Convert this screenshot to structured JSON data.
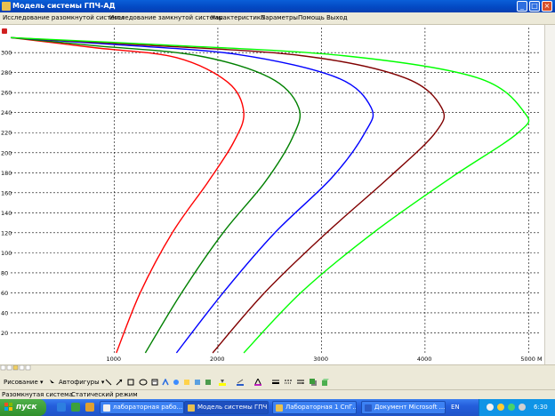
{
  "window": {
    "title": "Модель системы ГПЧ-АД",
    "minimize": "_",
    "maximize": "□",
    "close": "×"
  },
  "menu": [
    "Исследование разомкнутой системы",
    "Исследование замкнутой системы",
    "Характеристика",
    "Параметры",
    "Помощь",
    "Выход"
  ],
  "chart_data": {
    "type": "line",
    "xlabel": "M",
    "ylabel": "",
    "xlim": [
      0,
      5100
    ],
    "ylim": [
      0,
      325
    ],
    "x_ticks": [
      1000,
      2000,
      3000,
      4000,
      5000
    ],
    "y_ticks": [
      20,
      40,
      60,
      80,
      100,
      120,
      140,
      160,
      180,
      200,
      220,
      240,
      260,
      280,
      300
    ],
    "grid": "dashed",
    "series": [
      {
        "color": "#ff0000",
        "points": [
          [
            1020,
            0
          ],
          [
            1250,
            60
          ],
          [
            1560,
            120
          ],
          [
            1900,
            170
          ],
          [
            2150,
            210
          ],
          [
            2250,
            240
          ],
          [
            2100,
            270
          ],
          [
            1600,
            295
          ],
          [
            800,
            305
          ],
          [
            0,
            315
          ]
        ]
      },
      {
        "color": "#008000",
        "points": [
          [
            1300,
            0
          ],
          [
            1650,
            60
          ],
          [
            2050,
            120
          ],
          [
            2450,
            170
          ],
          [
            2720,
            215
          ],
          [
            2780,
            245
          ],
          [
            2500,
            275
          ],
          [
            1800,
            297
          ],
          [
            800,
            307
          ],
          [
            0,
            315
          ]
        ]
      },
      {
        "color": "#0000ff",
        "points": [
          [
            1600,
            0
          ],
          [
            2050,
            60
          ],
          [
            2550,
            120
          ],
          [
            3100,
            175
          ],
          [
            3420,
            220
          ],
          [
            3480,
            245
          ],
          [
            3150,
            275
          ],
          [
            2200,
            298
          ],
          [
            1000,
            308
          ],
          [
            0,
            315
          ]
        ]
      },
      {
        "color": "#800000",
        "points": [
          [
            1950,
            0
          ],
          [
            2450,
            60
          ],
          [
            3050,
            120
          ],
          [
            3650,
            175
          ],
          [
            4100,
            220
          ],
          [
            4160,
            245
          ],
          [
            3800,
            275
          ],
          [
            2800,
            297
          ],
          [
            1200,
            308
          ],
          [
            0,
            315
          ]
        ]
      },
      {
        "color": "#00ff00",
        "points": [
          [
            2250,
            0
          ],
          [
            2800,
            60
          ],
          [
            3500,
            120
          ],
          [
            4250,
            175
          ],
          [
            4900,
            220
          ],
          [
            4960,
            240
          ],
          [
            4500,
            275
          ],
          [
            3200,
            297
          ],
          [
            1400,
            308
          ],
          [
            0,
            315
          ]
        ]
      }
    ]
  },
  "toolbar": {
    "drawing_label": "Рисование ▾",
    "autoshapes_label": "Автофигуры ▾"
  },
  "status": {
    "mode1": "Разомкнутая система",
    "mode2": "Статический режим"
  },
  "taskbar": {
    "start": "пуск",
    "tasks": [
      {
        "label": "лабораторная рабо...",
        "color": "#f0f0f0",
        "active": false
      },
      {
        "label": "Модель системы ГПЧ...",
        "color": "#e8c050",
        "active": true
      },
      {
        "label": "Лабораторная 1 СпГ...",
        "color": "#e8c050",
        "active": false
      },
      {
        "label": "Документ Microsoft ...",
        "color": "#2a5cc8",
        "active": false
      }
    ],
    "lang": "EN",
    "clock": "6:30"
  }
}
